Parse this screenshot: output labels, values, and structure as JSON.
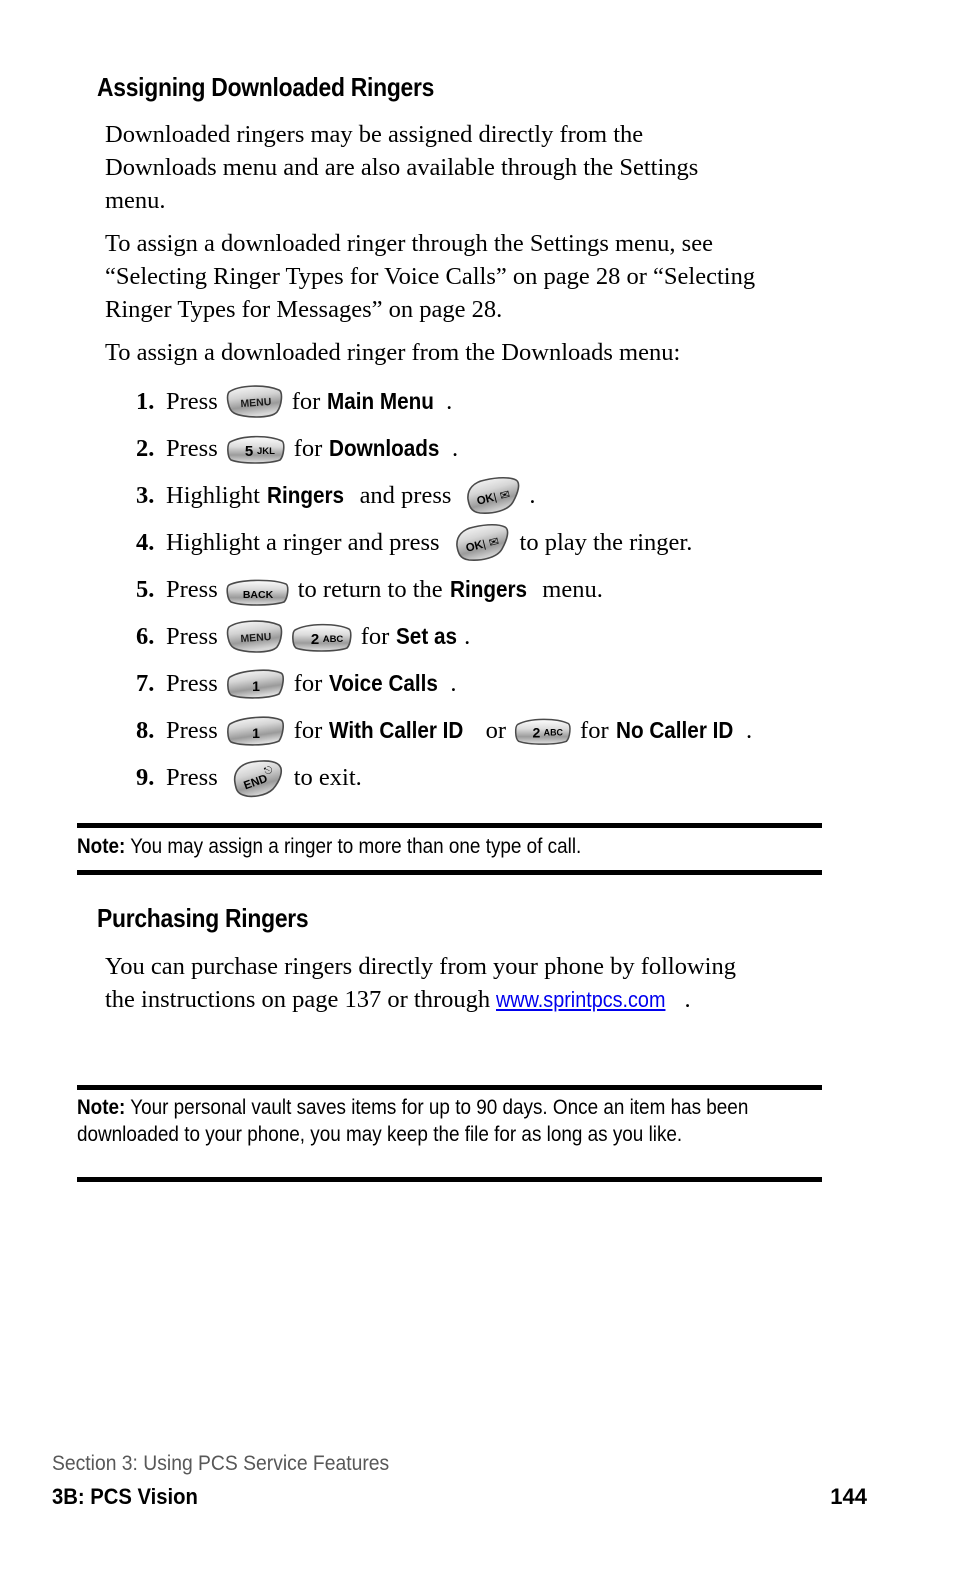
{
  "document": {
    "sections": [
      {
        "id": "assigning",
        "heading": "Assigning Downloaded Ringers",
        "paragraphs": [
          "Downloaded ringers may be assigned directly from the Downloads menu and are also available through the Settings menu.",
          "To assign a downloaded ringer through the Settings menu, see “Selecting Ringer Types for Voice Calls” on page 28 or “Selecting Ringer Types for Messages” on page 28.",
          "To assign a downloaded ringer from the Downloads menu:"
        ]
      },
      {
        "id": "purchasing",
        "heading": "Purchasing Ringers",
        "paragraphs": [
          "You can purchase ringers directly from your phone by following the instructions on page 137 or through"
        ],
        "link_text": "www.sprintpcs.com",
        "link_suffix": "."
      }
    ],
    "steps": [
      {
        "num": "1.",
        "pre": "Press",
        "keys": [
          "menu"
        ],
        "mid": "for",
        "strong": "Main Menu",
        "post": "."
      },
      {
        "num": "2.",
        "pre": "Press",
        "keys": [
          "5jkl"
        ],
        "mid": "for",
        "strong": "Downloads",
        "post": "."
      },
      {
        "num": "3.",
        "pre": "Highlight",
        "strong_lead": "Ringers",
        "mid_lead": "and press",
        "keys": [
          "ok"
        ],
        "post": "."
      },
      {
        "num": "4.",
        "pre": "Highlight a ringer and press",
        "keys": [
          "ok"
        ],
        "post": "to play the ringer."
      },
      {
        "num": "5.",
        "pre": "Press",
        "keys": [
          "back"
        ],
        "mid": "to return to the",
        "strong": "Ringers",
        "post": "menu."
      },
      {
        "num": "6.",
        "pre": "Press",
        "keys": [
          "menu",
          "2abc"
        ],
        "mid": "for",
        "strong": "Set as",
        "post": "."
      },
      {
        "num": "7.",
        "pre": "Press",
        "keys": [
          "1"
        ],
        "mid": "for",
        "strong": "Voice Calls",
        "post": "."
      },
      {
        "num": "8.",
        "pre": "Press",
        "keys": [
          "1"
        ],
        "mid": "for",
        "strong": "With Caller ID",
        "mid2": "or",
        "keys2": [
          "2abc"
        ],
        "mid3": "for",
        "strong2": "No Caller ID",
        "post": "."
      },
      {
        "num": "9.",
        "pre": "Press",
        "keys": [
          "end"
        ],
        "post": "to exit."
      }
    ],
    "keys": {
      "menu": {
        "label": "MENU",
        "shape": "soft-key-left"
      },
      "5jkl": {
        "label": "5",
        "sublabel": "JKL",
        "shape": "number-key"
      },
      "2abc": {
        "label": "2",
        "sublabel": "ABC",
        "shape": "number-key"
      },
      "1": {
        "label": "1",
        "shape": "number-key-plain"
      },
      "ok": {
        "label": "OK",
        "sublabel": "✉",
        "shape": "ok-key"
      },
      "back": {
        "label": "BACK",
        "shape": "back-key"
      },
      "end": {
        "label": "END",
        "sublabel": "ⓞ",
        "shape": "end-key"
      }
    },
    "notes": [
      {
        "label": "Note:",
        "text": "You may assign a ringer to more than one type of call."
      },
      {
        "label": "Note:",
        "text": "Your personal vault saves items for up to 90 days. Once an item has been downloaded to your phone, you may keep the file for as long as you like."
      }
    ],
    "footer": {
      "section": "Section 3: Using PCS Service Features",
      "title": "3B: PCS Vision",
      "page_number": "144"
    },
    "colors": {
      "text": "#000000",
      "footer_section": "#585858",
      "rule": "#000000",
      "key_light": "#f2f2f2",
      "key_mid": "#b8b8b8",
      "key_dark": "#6e6e6e"
    }
  }
}
